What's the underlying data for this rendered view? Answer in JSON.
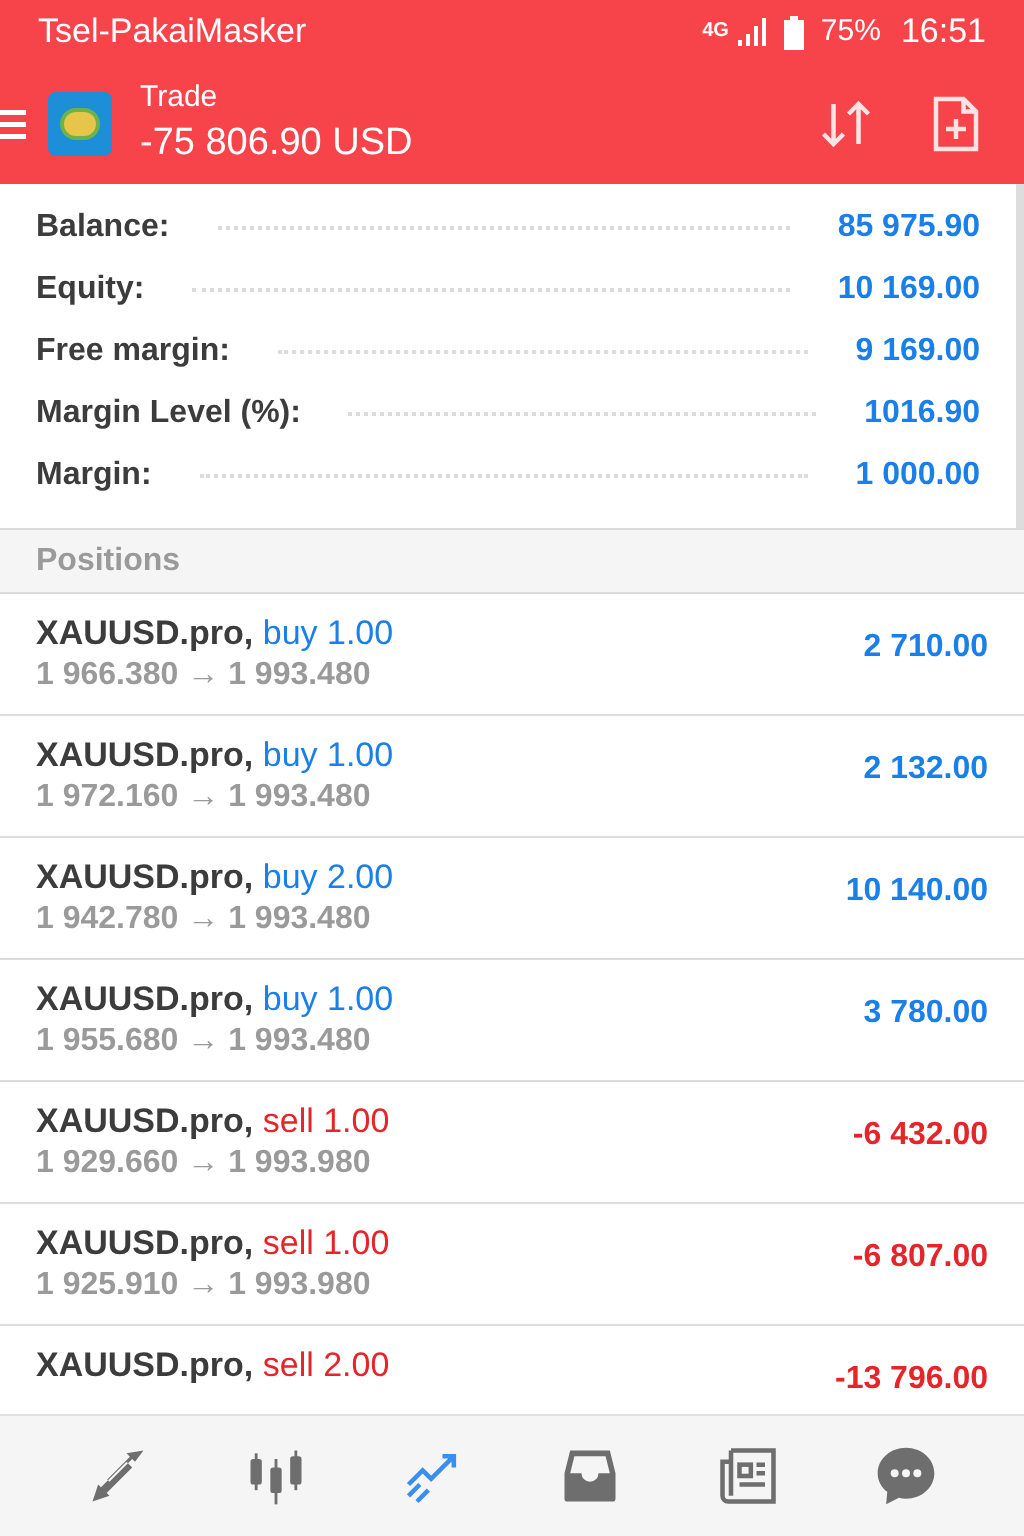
{
  "status_bar": {
    "carrier": "Tsel-PakaiMasker",
    "network": "4G",
    "battery": "75%",
    "time": "16:51"
  },
  "app_bar": {
    "title": "Trade",
    "subtitle": "-75 806.90 USD"
  },
  "summary": [
    {
      "label": "Balance:",
      "value": "85 975.90"
    },
    {
      "label": "Equity:",
      "value": "10 169.00"
    },
    {
      "label": "Free margin:",
      "value": "9 169.00"
    },
    {
      "label": "Margin Level (%):",
      "value": "1016.90"
    },
    {
      "label": "Margin:",
      "value": "1 000.00"
    }
  ],
  "positions_header": "Positions",
  "positions": [
    {
      "symbol": "XAUUSD.pro,",
      "kind": "buy",
      "order": "buy 1.00",
      "prices": "1 966.380 → 1 993.480",
      "profit": "2 710.00"
    },
    {
      "symbol": "XAUUSD.pro,",
      "kind": "buy",
      "order": "buy 1.00",
      "prices": "1 972.160 → 1 993.480",
      "profit": "2 132.00"
    },
    {
      "symbol": "XAUUSD.pro,",
      "kind": "buy",
      "order": "buy 2.00",
      "prices": "1 942.780 → 1 993.480",
      "profit": "10 140.00"
    },
    {
      "symbol": "XAUUSD.pro,",
      "kind": "buy",
      "order": "buy 1.00",
      "prices": "1 955.680 → 1 993.480",
      "profit": "3 780.00"
    },
    {
      "symbol": "XAUUSD.pro,",
      "kind": "sell",
      "order": "sell 1.00",
      "prices": "1 929.660 → 1 993.980",
      "profit": "-6 432.00"
    },
    {
      "symbol": "XAUUSD.pro,",
      "kind": "sell",
      "order": "sell 1.00",
      "prices": "1 925.910 → 1 993.980",
      "profit": "-6 807.00"
    },
    {
      "symbol": "XAUUSD.pro,",
      "kind": "sell",
      "order": "sell 2.00",
      "profit": "-13 796.00"
    }
  ],
  "bottom_nav": [
    {
      "selected": false
    },
    {
      "selected": false
    },
    {
      "selected": true
    },
    {
      "selected": false
    },
    {
      "selected": false
    },
    {
      "selected": false
    }
  ]
}
